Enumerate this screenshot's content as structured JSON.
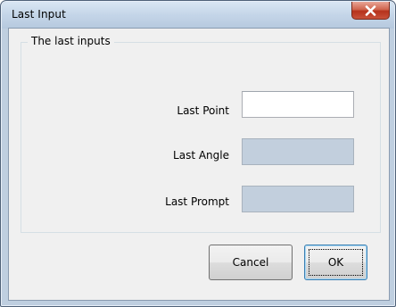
{
  "window": {
    "title": "Last Input",
    "close_glyph": "✕"
  },
  "group": {
    "legend": "The last inputs"
  },
  "fields": [
    {
      "label": "Last Point",
      "value": "",
      "enabled": true
    },
    {
      "label": "Last Angle",
      "value": "",
      "enabled": false
    },
    {
      "label": "Last Prompt",
      "value": "",
      "enabled": false
    }
  ],
  "buttons": {
    "cancel": "Cancel",
    "ok": "OK"
  },
  "colors": {
    "frame": "#bfcfe0",
    "close_red": "#c8513a",
    "disabled_field": "#c2cfdd",
    "client_bg": "#f0f0f0"
  }
}
